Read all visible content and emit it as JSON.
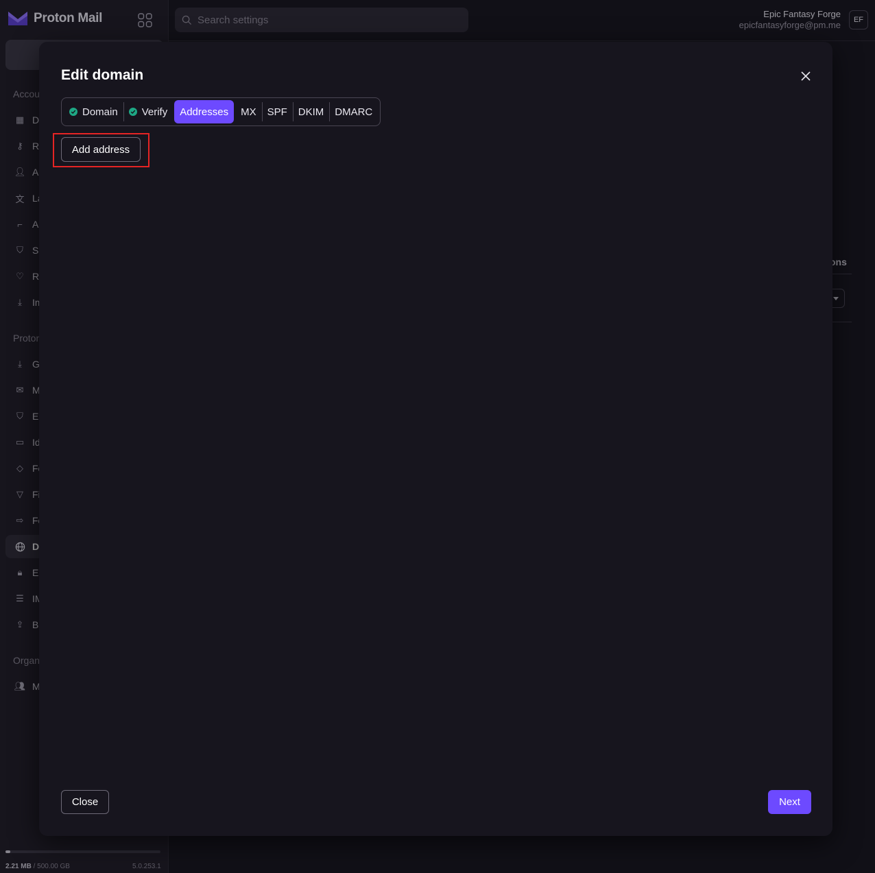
{
  "app": {
    "name": "Proton Mail",
    "brand_color": "#6d4aff"
  },
  "search": {
    "placeholder": "Search settings"
  },
  "user": {
    "name": "Epic Fantasy Forge",
    "email": "epicfantasyforge@pm.me",
    "initials": "EF"
  },
  "sidebar": {
    "sections": [
      {
        "label": "Accou"
      },
      {
        "label": "Proton"
      },
      {
        "label": "Organ"
      }
    ],
    "items": [
      {
        "label": "Da",
        "icon": "dashboard-icon"
      },
      {
        "label": "Re",
        "icon": "key-icon"
      },
      {
        "label": "Ac",
        "icon": "user-icon"
      },
      {
        "label": "La",
        "icon": "language-icon"
      },
      {
        "label": "Ap",
        "icon": "paint-roller-icon"
      },
      {
        "label": "Se",
        "icon": "shield-icon"
      },
      {
        "label": "Re",
        "icon": "heart-icon"
      },
      {
        "label": "Im",
        "icon": "import-icon"
      },
      {
        "label": "Ge",
        "icon": "download-icon"
      },
      {
        "label": "M",
        "icon": "envelope-icon"
      },
      {
        "label": "En",
        "icon": "shield-icon"
      },
      {
        "label": "Id",
        "icon": "id-card-icon"
      },
      {
        "label": "Fo",
        "icon": "tag-icon"
      },
      {
        "label": "Fi",
        "icon": "filter-icon"
      },
      {
        "label": "Fo",
        "icon": "forward-icon"
      },
      {
        "label": "Do",
        "icon": "globe-icon"
      },
      {
        "label": "En",
        "icon": "lock-icon"
      },
      {
        "label": "IM",
        "icon": "server-icon"
      },
      {
        "label": "Ba",
        "icon": "export-icon"
      },
      {
        "label": "M",
        "icon": "users-icon"
      }
    ],
    "storage": {
      "used": "2.21 MB",
      "separator": " / ",
      "total": "500.00 GB",
      "used_fraction": 0.03
    },
    "version": "5.0.253.1"
  },
  "background": {
    "column_fragment": "ons"
  },
  "modal": {
    "title": "Edit domain",
    "tabs": [
      {
        "label": "Domain",
        "done": true
      },
      {
        "label": "Verify",
        "done": true
      },
      {
        "label": "Addresses",
        "active": true
      },
      {
        "label": "MX"
      },
      {
        "label": "SPF"
      },
      {
        "label": "DKIM"
      },
      {
        "label": "DMARC"
      }
    ],
    "add_address_label": "Add address",
    "close_label": "Close",
    "next_label": "Next"
  }
}
